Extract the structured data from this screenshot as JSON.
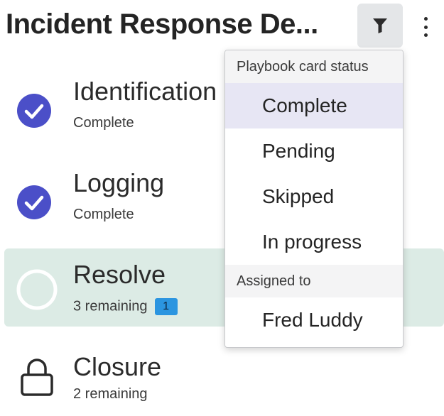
{
  "header": {
    "title": "Incident Response De...",
    "filter_icon": "funnel-icon",
    "more_icon": "kebab-menu-icon"
  },
  "steps": [
    {
      "name": "Identification",
      "status": "Complete",
      "icon": "check-circle-icon"
    },
    {
      "name": "Logging",
      "status": "Complete",
      "icon": "check-circle-icon"
    },
    {
      "name": "Resolve",
      "status": "3 remaining",
      "badge": "1",
      "icon": "empty-circle-icon"
    },
    {
      "name": "Closure",
      "status": "2 remaining",
      "icon": "lock-icon"
    }
  ],
  "filter_menu": {
    "section_status_label": "Playbook card status",
    "status_options": [
      "Complete",
      "Pending",
      "Skipped",
      "In progress"
    ],
    "selected_status": "Complete",
    "section_assigned_label": "Assigned to",
    "assigned_options": [
      "Fred Luddy"
    ]
  },
  "colors": {
    "check_circle": "#4b4fc8",
    "active_row": "#dcebe5",
    "badge": "#2b95e0",
    "selected_option": "#e7e6f4"
  }
}
